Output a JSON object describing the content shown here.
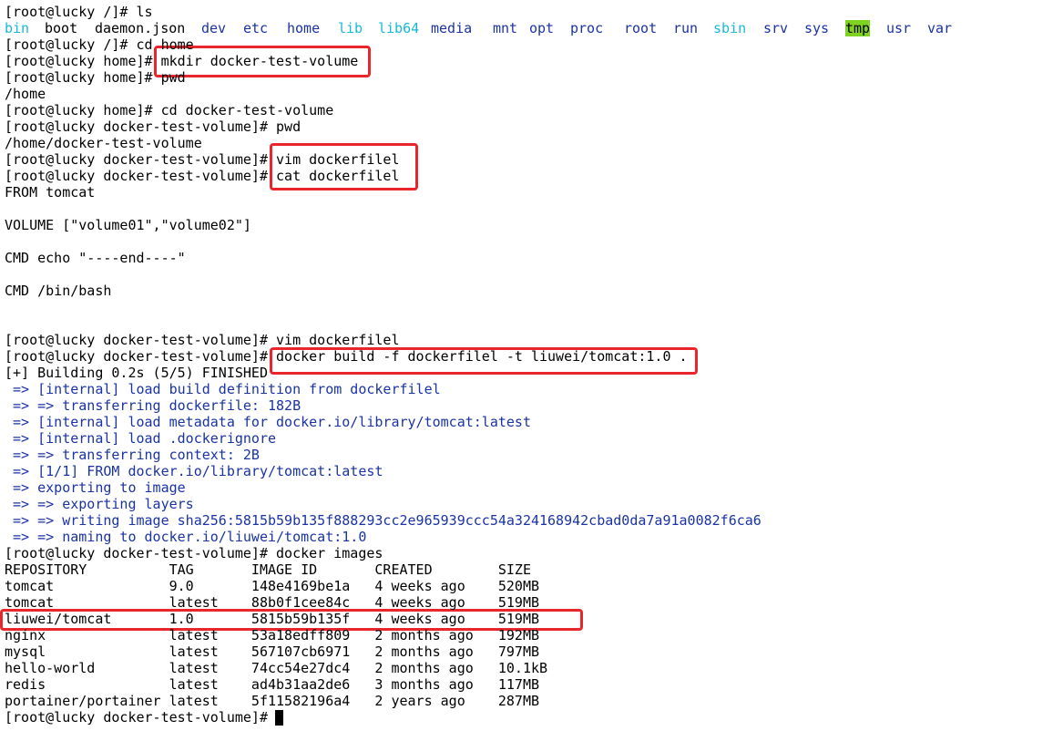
{
  "terminal": {
    "lines": [
      {
        "text": "[root@lucky /]# ls"
      },
      {
        "segments": [
          {
            "text": "bin",
            "color": "cyan"
          },
          {
            "text": "boot"
          },
          {
            "text": "daemon.json"
          },
          {
            "text": "dev",
            "color": "blue"
          },
          {
            "text": "etc",
            "color": "blue"
          },
          {
            "text": "home",
            "color": "blue"
          },
          {
            "text": "lib",
            "color": "cyan"
          },
          {
            "text": "lib64",
            "color": "cyan"
          },
          {
            "text": "media",
            "color": "blue"
          },
          {
            "text": "mnt",
            "color": "blue"
          },
          {
            "text": "opt",
            "color": "blue"
          },
          {
            "text": "proc",
            "color": "blue"
          },
          {
            "text": "root",
            "color": "blue"
          },
          {
            "text": "run",
            "color": "blue"
          },
          {
            "text": "sbin",
            "color": "cyan"
          },
          {
            "text": "srv",
            "color": "blue"
          },
          {
            "text": "sys",
            "color": "blue"
          },
          {
            "text": "tmp",
            "color": "highlight"
          },
          {
            "text": "usr",
            "color": "blue"
          },
          {
            "text": "var",
            "color": "blue"
          }
        ]
      },
      {
        "text": "[root@lucky /]# cd home"
      },
      {
        "text": "[root@lucky home]# mkdir docker-test-volume"
      },
      {
        "text": "[root@lucky home]# pwd"
      },
      {
        "text": "/home"
      },
      {
        "text": "[root@lucky home]# cd docker-test-volume"
      },
      {
        "text": "[root@lucky docker-test-volume]# pwd"
      },
      {
        "text": "/home/docker-test-volume"
      },
      {
        "text": "[root@lucky docker-test-volume]# vim dockerfilel"
      },
      {
        "text": "[root@lucky docker-test-volume]# cat dockerfilel"
      },
      {
        "text": "FROM tomcat"
      },
      {
        "text": ""
      },
      {
        "text": "VOLUME [\"volume01\",\"volume02\"]"
      },
      {
        "text": ""
      },
      {
        "text": "CMD echo \"----end----\""
      },
      {
        "text": ""
      },
      {
        "text": "CMD /bin/bash"
      },
      {
        "text": ""
      },
      {
        "text": ""
      },
      {
        "text": "[root@lucky docker-test-volume]# vim dockerfilel"
      },
      {
        "text": "[root@lucky docker-test-volume]# docker build -f dockerfilel -t liuwei/tomcat:1.0 ."
      },
      {
        "text": "[+] Building 0.2s (5/5) FINISHED"
      },
      {
        "text": " => [internal] load build definition from dockerfilel",
        "color": "blue"
      },
      {
        "text": " => => transferring dockerfile: 182B",
        "color": "blue"
      },
      {
        "text": " => [internal] load metadata for docker.io/library/tomcat:latest",
        "color": "blue"
      },
      {
        "text": " => [internal] load .dockerignore",
        "color": "blue"
      },
      {
        "text": " => => transferring context: 2B",
        "color": "blue"
      },
      {
        "text": " => [1/1] FROM docker.io/library/tomcat:latest",
        "color": "blue"
      },
      {
        "text": " => exporting to image",
        "color": "blue"
      },
      {
        "text": " => => exporting layers",
        "color": "blue"
      },
      {
        "text": " => => writing image sha256:5815b59b135f888293cc2e965939ccc54a324168942cbad0da7a91a0082f6ca6",
        "color": "blue"
      },
      {
        "text": " => => naming to docker.io/liuwei/tomcat:1.0",
        "color": "blue"
      },
      {
        "text": "[root@lucky docker-test-volume]# docker images"
      },
      {
        "text": "REPOSITORY          TAG       IMAGE ID       CREATED        SIZE"
      },
      {
        "text": "tomcat              9.0       148e4169be1a   4 weeks ago    520MB"
      },
      {
        "text": "tomcat              latest    88b0f1cee84c   4 weeks ago    519MB"
      },
      {
        "text": "liuwei/tomcat       1.0       5815b59b135f   4 weeks ago    519MB"
      },
      {
        "text": "nginx               latest    53a18edff809   2 months ago   192MB"
      },
      {
        "text": "mysql               latest    567107cb6971   2 months ago   797MB"
      },
      {
        "text": "hello-world         latest    74cc54e27dc4   2 months ago   10.1kB"
      },
      {
        "text": "redis               latest    ad4b31aa2de6   3 months ago   117MB"
      },
      {
        "text": "portainer/portainer latest    5f11582196a4   2 years ago    287MB"
      },
      {
        "text": "[root@lucky docker-test-volume]# "
      }
    ]
  },
  "colors": {
    "text": "#000000",
    "blue": "#1a33a6",
    "cyan": "#17b9d8",
    "highlight": "#7ed321",
    "annotation": "#e8262b"
  }
}
